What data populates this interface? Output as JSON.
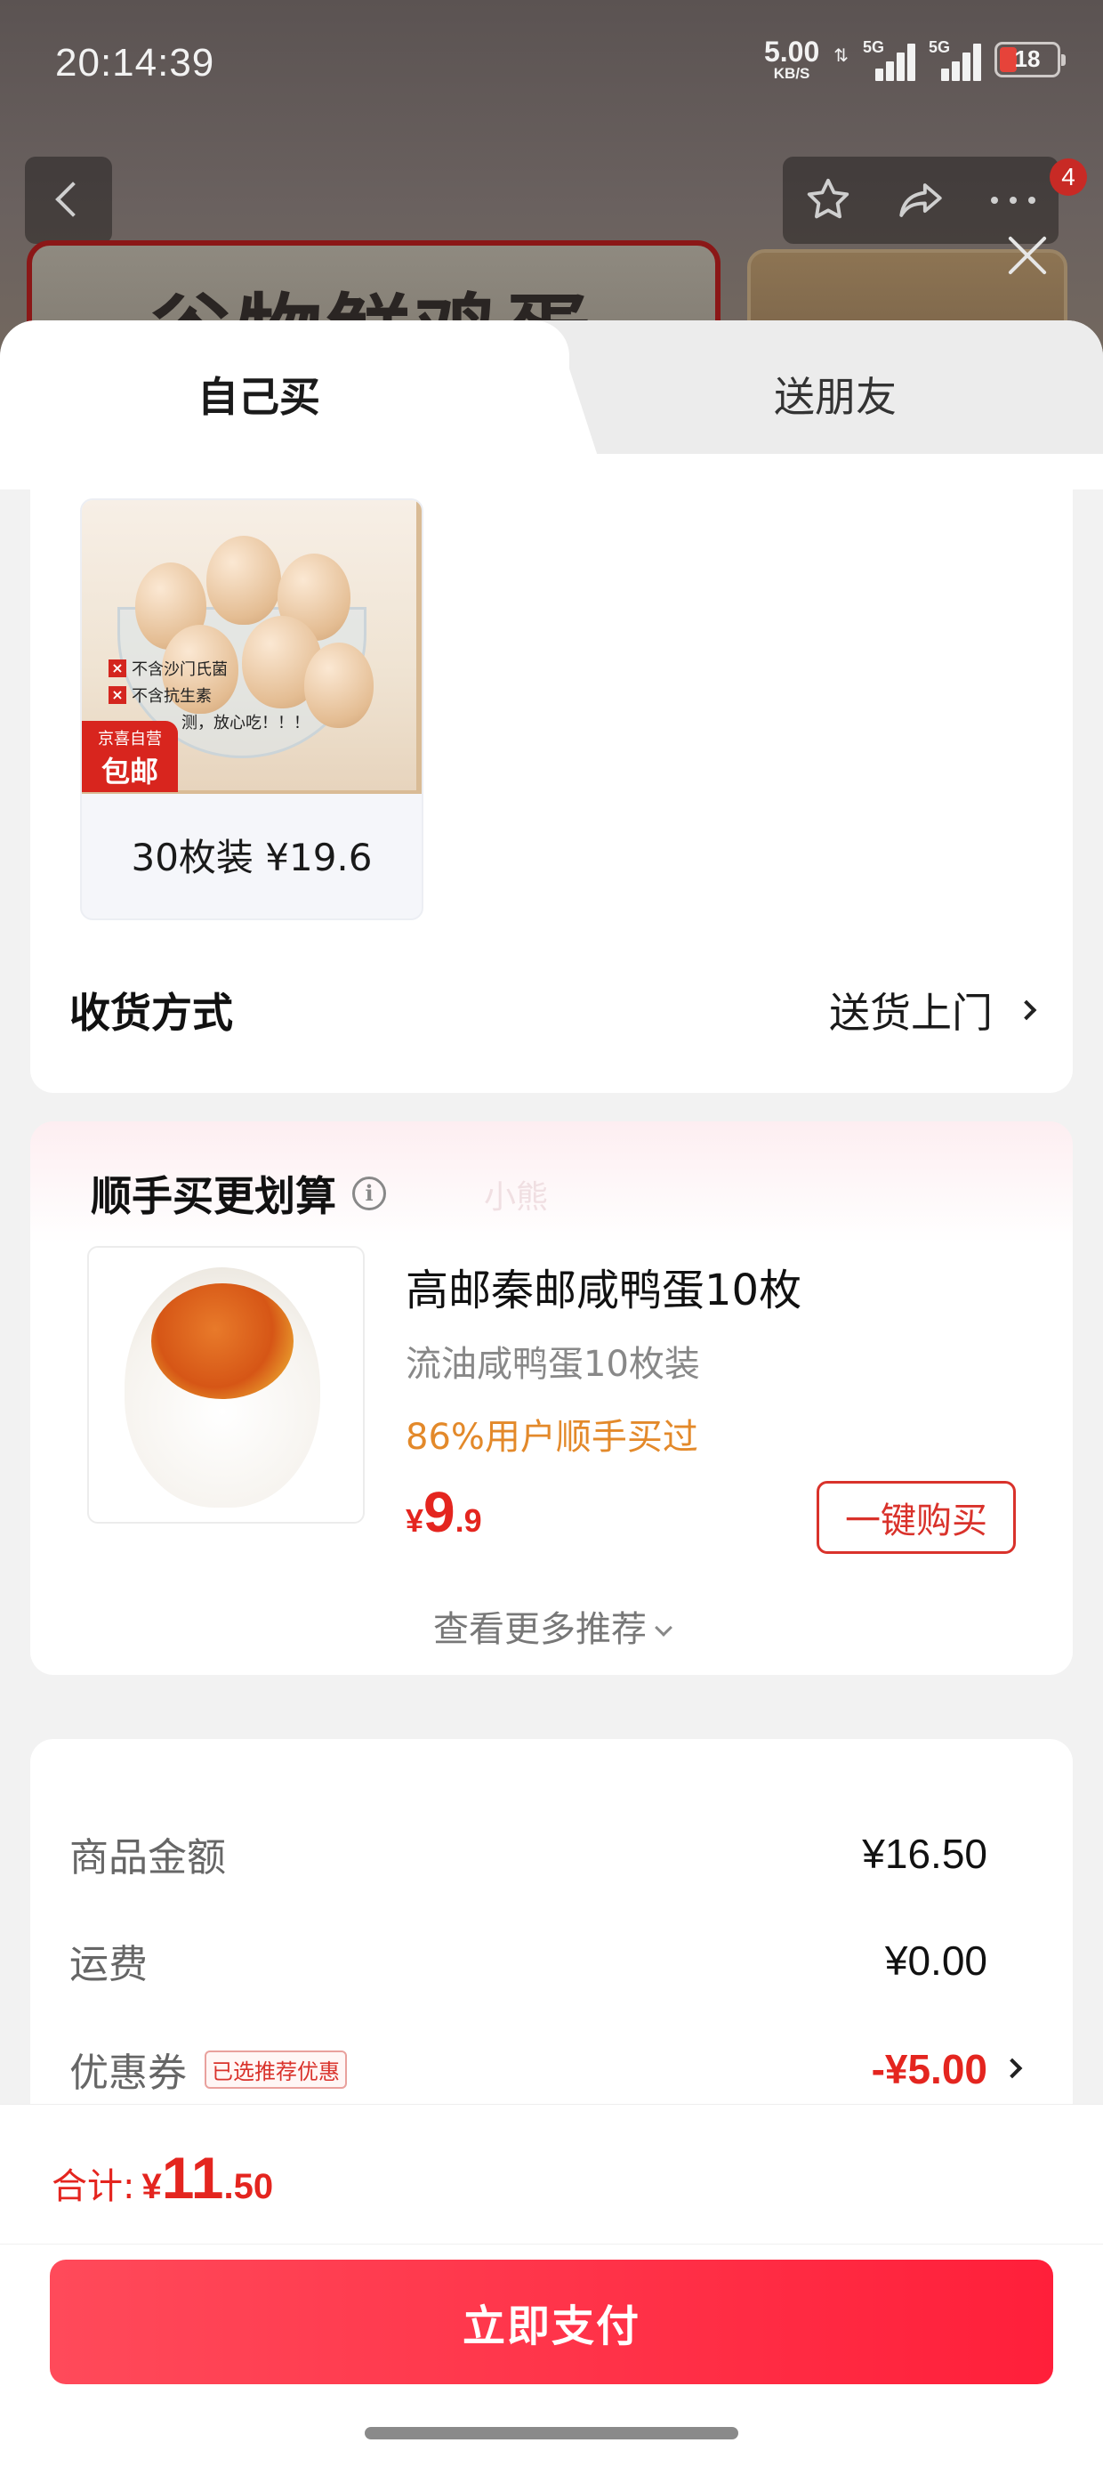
{
  "status_bar": {
    "time": "20:14:39",
    "net_speed": "5.00",
    "net_unit": "KB/S",
    "signal_1": "5G",
    "signal_2": "5G",
    "battery": "18"
  },
  "background": {
    "banner_text": "谷物鲜鸡蛋",
    "cart_badge": "4"
  },
  "tabs": {
    "self_buy": "自己买",
    "gift": "送朋友"
  },
  "product": {
    "label_1": "不含沙门氏菌",
    "label_2": "不含抗生素",
    "label_3": "测，放心吃！！！",
    "badge_top": "京喜自营",
    "badge_bottom": "包邮",
    "caption": "30枚装 ¥19.6"
  },
  "delivery": {
    "label": "收货方式",
    "value": "送货上门"
  },
  "recommendation": {
    "title": "顺手买更划算",
    "watermark": "小熊",
    "name": "高邮秦邮咸鸭蛋10枚",
    "subtitle": "流油咸鸭蛋10枚装",
    "bought": "86%用户顺手买过",
    "price_currency": "¥",
    "price_int": "9",
    "price_dec": ".9",
    "buy_button": "一键购买",
    "more": "查看更多推荐"
  },
  "summary": {
    "goods_label": "商品金额",
    "goods_value": "¥16.50",
    "shipping_label": "运费",
    "shipping_value": "¥0.00",
    "coupon_label": "优惠券",
    "coupon_tag": "已选推荐优惠",
    "coupon_value": "-¥5.00"
  },
  "footer": {
    "total_label": "合计:",
    "total_currency": "¥",
    "total_int": "11",
    "total_dec": ".50",
    "pay_button": "立即支付"
  },
  "colors": {
    "accent_red": "#e4251f",
    "pay_gradient_start": "#ff4a5a",
    "pay_gradient_end": "#ff1f3a",
    "orange_text": "#e3892a"
  }
}
